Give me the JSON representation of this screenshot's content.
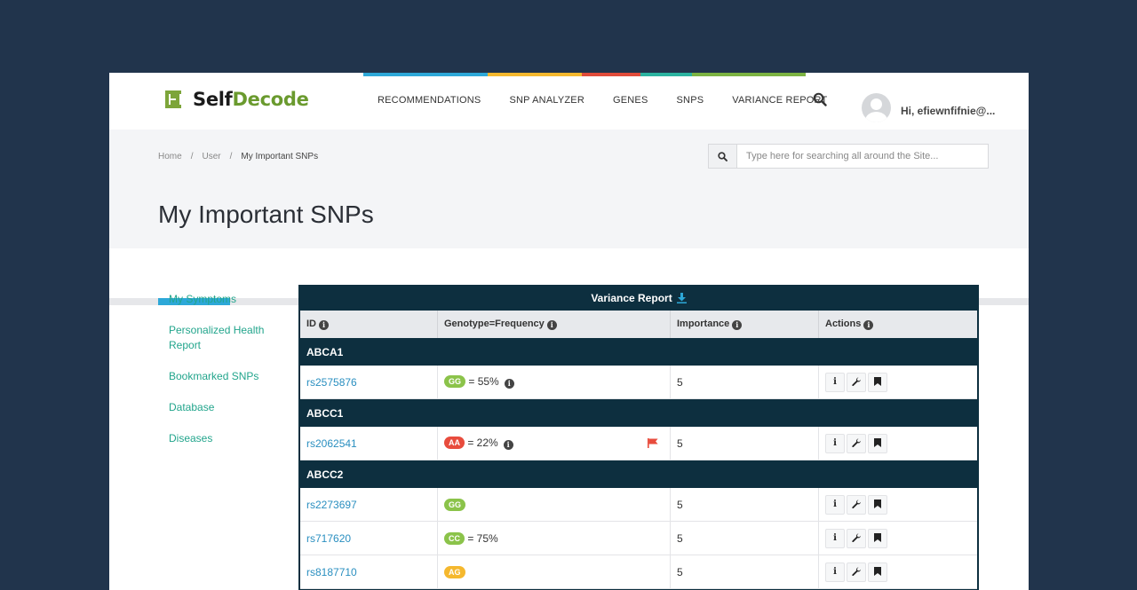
{
  "brand": {
    "name_part1": "Self",
    "name_part2": "Decode"
  },
  "top_color_bar": [
    "#2da8d8",
    "#f5b82e",
    "#e04b3a",
    "#2bb3a0",
    "#7cb342"
  ],
  "nav": {
    "items": [
      "RECOMMENDATIONS",
      "SNP ANALYZER",
      "GENES",
      "SNPS",
      "VARIANCE REPORT"
    ],
    "search_icon": "search-icon"
  },
  "user": {
    "greeting": "Hi, efiewnfifnie@..."
  },
  "breadcrumb": {
    "home": "Home",
    "user": "User",
    "current": "My Important SNPs",
    "separator": "/"
  },
  "site_search": {
    "placeholder": "Type here for searching all around the Site..."
  },
  "page": {
    "title": "My Important SNPs"
  },
  "sidebar": {
    "items": [
      "My Symptoms",
      "Personalized Health Report",
      "Bookmarked SNPs",
      "Database",
      "Diseases"
    ]
  },
  "report": {
    "title": "Variance Report",
    "columns": [
      "ID",
      "Genotype=Frequency",
      "Importance",
      "Actions"
    ],
    "groups": [
      {
        "gene": "ABCA1",
        "rows": [
          {
            "id": "rs2575876",
            "genotype": "GG",
            "genotype_color": "#8bc34a",
            "frequency": "= 55%",
            "has_info": true,
            "flag": false,
            "importance": "5"
          }
        ]
      },
      {
        "gene": "ABCC1",
        "rows": [
          {
            "id": "rs2062541",
            "genotype": "AA",
            "genotype_color": "#e84c3d",
            "frequency": "= 22%",
            "has_info": true,
            "flag": true,
            "importance": "5"
          }
        ]
      },
      {
        "gene": "ABCC2",
        "rows": [
          {
            "id": "rs2273697",
            "genotype": "GG",
            "genotype_color": "#8bc34a",
            "frequency": "",
            "has_info": false,
            "flag": false,
            "importance": "5"
          },
          {
            "id": "rs717620",
            "genotype": "CC",
            "genotype_color": "#8bc34a",
            "frequency": "= 75%",
            "has_info": false,
            "flag": false,
            "importance": "5"
          },
          {
            "id": "rs8187710",
            "genotype": "AG",
            "genotype_color": "#f5b82e",
            "frequency": "",
            "has_info": false,
            "flag": false,
            "importance": "5"
          }
        ]
      }
    ],
    "action_icons": [
      "info-icon",
      "wrench-icon",
      "bookmark-icon"
    ],
    "info_glyph": "i"
  }
}
